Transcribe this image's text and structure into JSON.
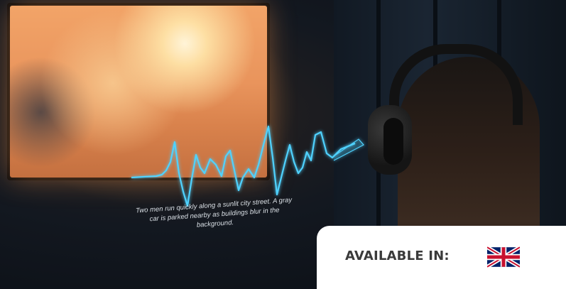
{
  "caption": "Two men run quickly along a sunlit city street. A gray car is parked nearby as buildings blur in the background.",
  "availability": {
    "label": "AVAILABLE IN:",
    "flag_icon": "uk-flag-icon"
  },
  "colors": {
    "waveform": "#4fd2ff",
    "card_bg": "#ffffff",
    "label_text": "#3a3a3a"
  }
}
